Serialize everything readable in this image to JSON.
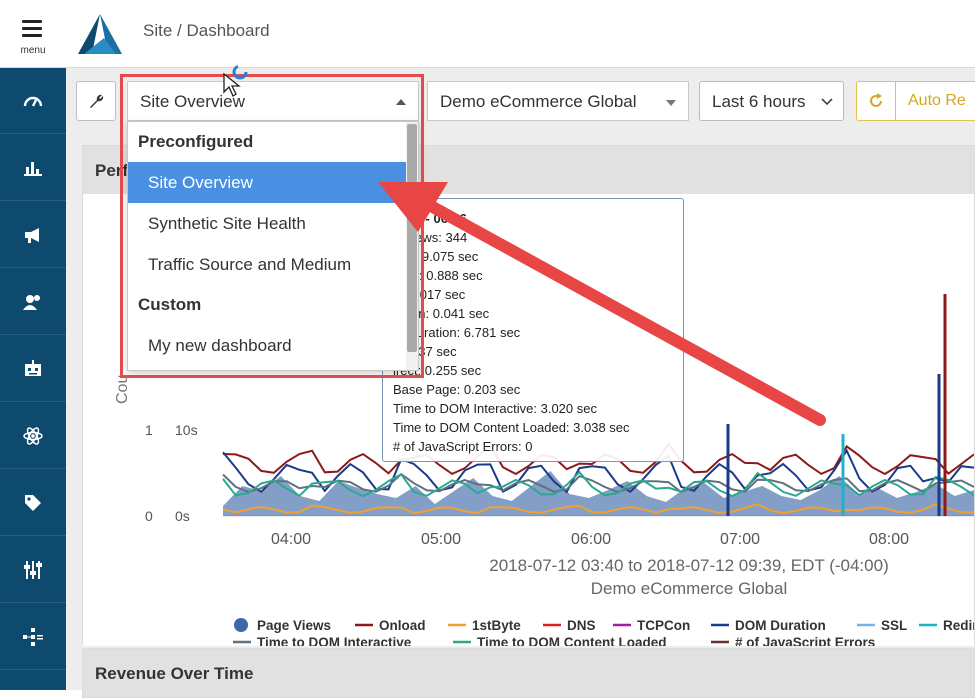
{
  "header": {
    "menu_label": "menu",
    "breadcrumb": "Site / Dashboard"
  },
  "sidebar": {
    "items": [
      {
        "icon": "gauge-icon"
      },
      {
        "icon": "bar-chart-icon"
      },
      {
        "icon": "megaphone-icon"
      },
      {
        "icon": "users-icon"
      },
      {
        "icon": "robot-icon"
      },
      {
        "icon": "atom-icon"
      },
      {
        "icon": "tag-icon"
      },
      {
        "icon": "sliders-icon"
      },
      {
        "icon": "network-icon"
      }
    ]
  },
  "toolbar": {
    "dashboard_selected": "Site Overview",
    "site_selected": "Demo eCommerce Global",
    "time_selected": "Last 6 hours",
    "auto_refresh_label": "Auto Re"
  },
  "dropdown": {
    "groups": [
      {
        "label": "Preconfigured",
        "items": [
          "Site Overview",
          "Synthetic Site Health",
          "Traffic Source and Medium"
        ]
      },
      {
        "label": "Custom",
        "items": [
          "My new dashboard"
        ]
      }
    ],
    "active_item": "Site Overview"
  },
  "panels": {
    "performance_title": "Perf",
    "revenue_title": "Revenue Over Time"
  },
  "tooltip": {
    "lines": [
      "2018 - 06:36",
      "e Views: 344",
      "oad: 9.075 sec",
      "Byte: 0.888 sec",
      "S: 0.017 sec",
      "PCon: 0.041 sec",
      "M Duration: 6.781 sec",
      ": 0.037 sec",
      "irect: 0.255 sec",
      "Base Page: 0.203 sec",
      "Time to DOM Interactive: 3.020 sec",
      "Time to DOM Content Loaded: 3.038 sec",
      "# of JavaScript Errors: 0"
    ]
  },
  "chart_data": {
    "type": "line",
    "title": "",
    "subtitle": "2018-07-12 03:40 to 2018-07-12 09:39, EDT (-04:00)",
    "site_label": "Demo eCommerce Global",
    "ylabel": "Cou",
    "x_ticks": [
      "04:00",
      "05:00",
      "06:00",
      "07:00",
      "08:00"
    ],
    "y_ticks_left": [
      "0",
      "1"
    ],
    "y_ticks_right": [
      "0s",
      "10s"
    ],
    "legend": [
      {
        "name": "Page Views",
        "color": "#3a6aa8",
        "marker": "dot"
      },
      {
        "name": "Onload",
        "color": "#8b1a1a"
      },
      {
        "name": "1stByte",
        "color": "#f0a030"
      },
      {
        "name": "DNS",
        "color": "#e02020"
      },
      {
        "name": "TCPCon",
        "color": "#a020a0"
      },
      {
        "name": "DOM Duration",
        "color": "#1a3a8a"
      },
      {
        "name": "SSL",
        "color": "#7ab0e8"
      },
      {
        "name": "Redire",
        "color": "#20b0c8"
      },
      {
        "name": "Time to DOM Interactive",
        "color": "#607080"
      },
      {
        "name": "Time to DOM Content Loaded",
        "color": "#2aa890"
      },
      {
        "name": "# of JavaScript Errors",
        "color": "#6a3030"
      }
    ]
  }
}
